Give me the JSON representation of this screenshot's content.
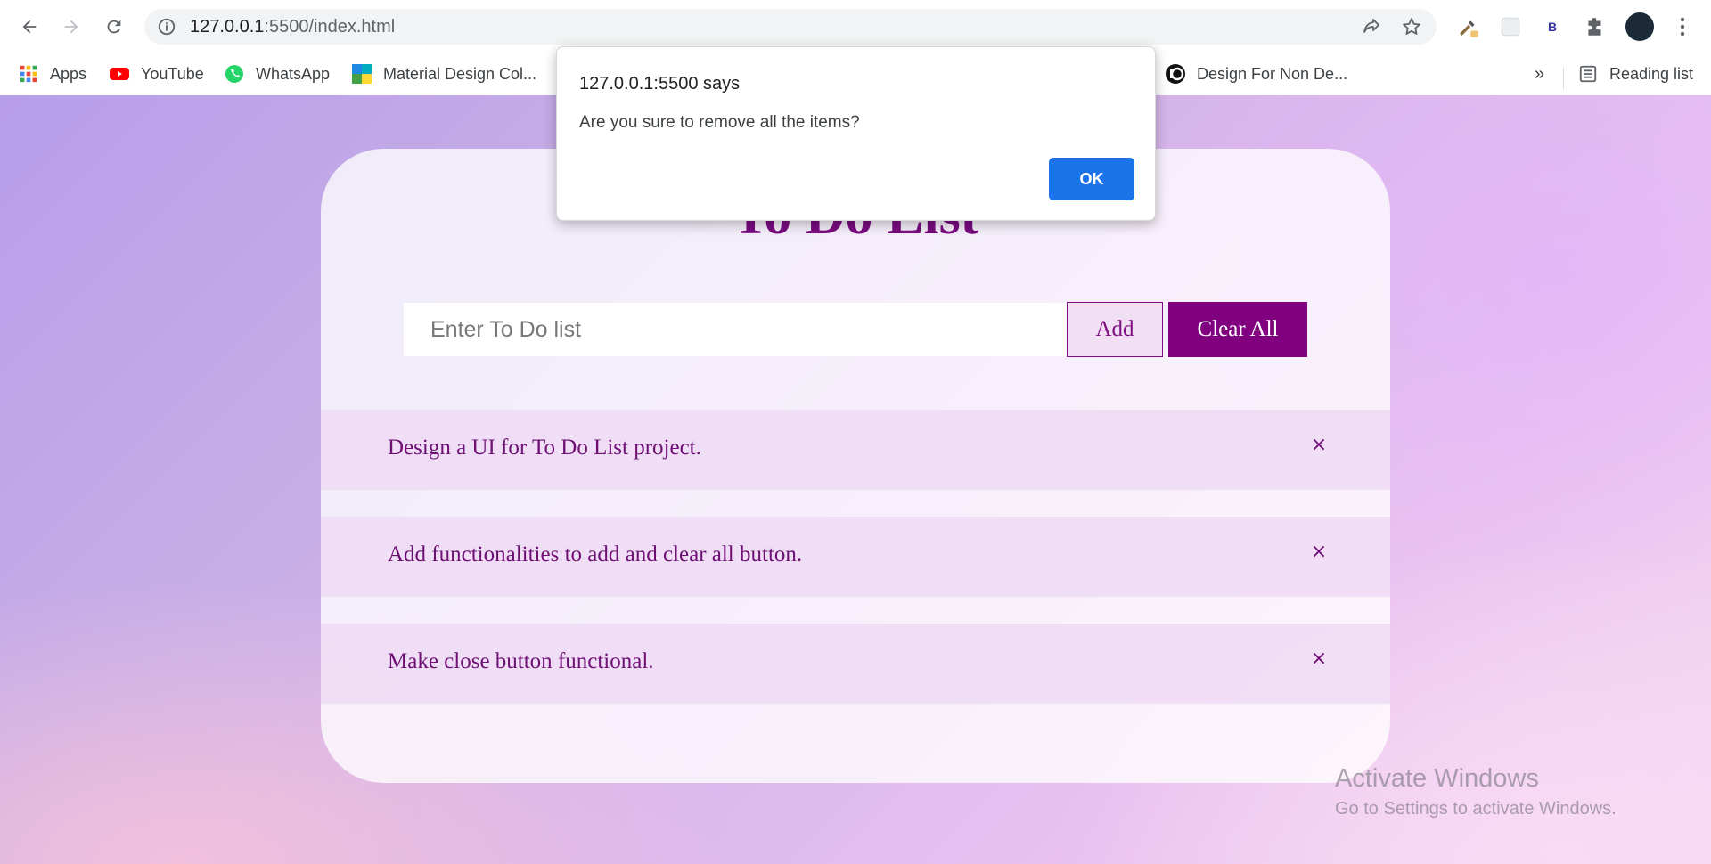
{
  "browser": {
    "url_host": "127.0.0.1",
    "url_rest": ":5500/index.html",
    "bookmarks": [
      {
        "label": "Apps",
        "icon": "apps-grid-icon"
      },
      {
        "label": "YouTube",
        "icon": "youtube-icon"
      },
      {
        "label": "WhatsApp",
        "icon": "whatsapp-icon"
      },
      {
        "label": "Material Design Col...",
        "icon": "material-design-icon"
      },
      {
        "label": "Design For Non De...",
        "icon": "design-site-icon"
      }
    ],
    "bookmarks_overflow": "»",
    "reading_list": "Reading list",
    "extension_badge": "B"
  },
  "app": {
    "title": "To Do List",
    "input_placeholder": "Enter To Do list",
    "add_label": "Add",
    "clear_label": "Clear All",
    "close_glyph": "×",
    "items": [
      {
        "text": "Design a UI for To Do List project."
      },
      {
        "text": "Add functionalities to add and clear all button."
      },
      {
        "text": "Make close button functional."
      }
    ]
  },
  "dialog": {
    "origin": "127.0.0.1:5500 says",
    "message": "Are you sure to remove all the items?",
    "ok_label": "OK"
  },
  "watermark": {
    "line1": "Activate Windows",
    "line2": "Go to Settings to activate Windows."
  },
  "colors": {
    "accent_purple": "#800080",
    "dialog_button": "#1a73e8"
  }
}
